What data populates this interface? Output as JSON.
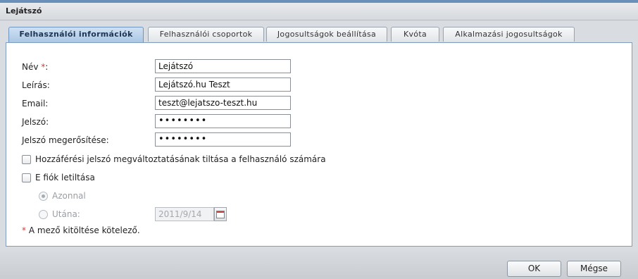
{
  "window": {
    "title": "Lejátszó"
  },
  "tabs": [
    {
      "label": "Felhasználói információk",
      "active": true
    },
    {
      "label": "Felhasználói csoportok",
      "active": false
    },
    {
      "label": "Jogosultságok beállítása",
      "active": false
    },
    {
      "label": "Kvóta",
      "active": false
    },
    {
      "label": "Alkalmazási jogosultságok",
      "active": false
    }
  ],
  "form": {
    "name": {
      "label": "Név",
      "required_marker": "*",
      "suffix": ":",
      "value": "Lejátszó"
    },
    "desc": {
      "label": "Leírás:",
      "value": "Lejátszó.hu Teszt"
    },
    "email": {
      "label": "Email:",
      "value": "teszt@lejatszo-teszt.hu"
    },
    "password": {
      "label": "Jelszó:",
      "value": "••••••••"
    },
    "confirm": {
      "label": "Jelszó megerősítése:",
      "value": "••••••••"
    }
  },
  "options": {
    "disallow_pw_change": {
      "label": "Hozzáférési jelszó megváltoztatásának tiltása a felhasználó számára",
      "checked": false
    },
    "disable_account": {
      "label": "E fiók letiltása",
      "checked": false
    },
    "now": {
      "label": "Azonnal",
      "selected": true,
      "disabled": true
    },
    "after": {
      "label": "Utána:",
      "selected": false,
      "disabled": true
    },
    "after_date": "2011/9/14"
  },
  "footnote": {
    "marker": "*",
    "text": "A mező kitöltése kötelező."
  },
  "buttons": {
    "ok": "OK",
    "cancel": "Mégse"
  },
  "colors": {
    "required": "#d83a2d",
    "active_tab": "#a9c6e4",
    "panel_border": "#7f9dc0"
  }
}
